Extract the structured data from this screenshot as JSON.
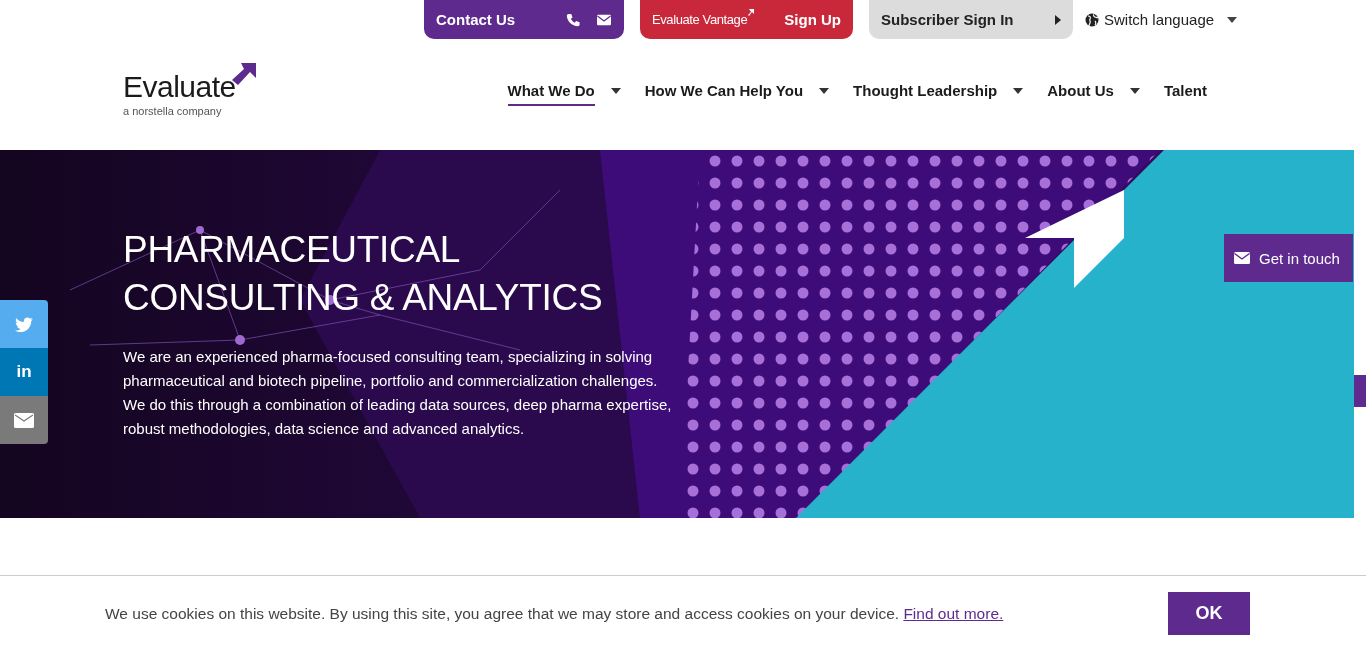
{
  "top_bar": {
    "contact": {
      "label": "Contact Us"
    },
    "vantage": {
      "brand": "Evaluate Vantage",
      "label": "Sign Up"
    },
    "subscriber": {
      "label": "Subscriber Sign In"
    },
    "language": {
      "label": "Switch language"
    }
  },
  "logo": {
    "name": "Evaluate",
    "tagline": "a norstella company"
  },
  "nav": [
    {
      "label": "What We Do",
      "selected": true,
      "dropdown": true
    },
    {
      "label": "How We Can Help You",
      "selected": false,
      "dropdown": true
    },
    {
      "label": "Thought Leadership",
      "selected": false,
      "dropdown": true
    },
    {
      "label": "About Us",
      "selected": false,
      "dropdown": true
    },
    {
      "label": "Talent",
      "selected": false,
      "dropdown": false
    }
  ],
  "hero": {
    "title": "PHARMACEUTICAL CONSULTING & ANALYTICS",
    "description": "We are an experienced pharma-focused consulting team, specializing in solving pharmaceutical and biotech pipeline, portfolio and commercialization challenges. We do this through a combination of leading data sources, deep pharma expertise, robust methodologies, data science and advanced analytics."
  },
  "social": [
    {
      "kind": "twitter"
    },
    {
      "kind": "linkedin",
      "label": "in"
    },
    {
      "kind": "email"
    }
  ],
  "get_in_touch": {
    "label": "Get in touch"
  },
  "cookie": {
    "text": "We use cookies on this website. By using this site, you agree that we may store and access cookies on your device.",
    "link": "Find out more.",
    "button": "OK"
  }
}
